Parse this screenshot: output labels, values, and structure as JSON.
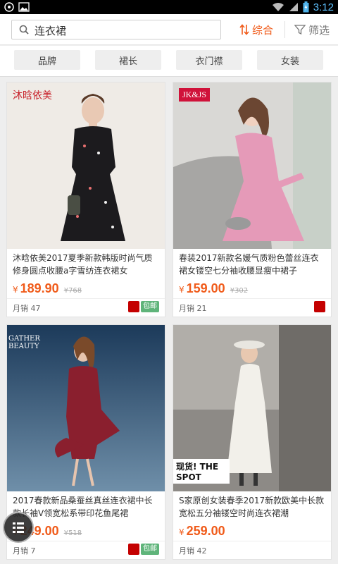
{
  "status_bar": {
    "time": "3:12"
  },
  "search": {
    "query": "连衣裙"
  },
  "sort": {
    "label": "综合"
  },
  "filter": {
    "label": "筛选"
  },
  "chips": [
    "品牌",
    "裙长",
    "衣门襟",
    "女装"
  ],
  "products": [
    {
      "brand_label": "沐晗依美",
      "title": "沐晗依美2017夏季新款韩版时尚气质修身圆点收腰a字雪纺连衣裙女",
      "currency": "¥",
      "price": "189.90",
      "original_price": "¥768",
      "sales": "月销 47",
      "badge": "包邮"
    },
    {
      "brand_label": "JK&JS",
      "title": "春装2017新款名媛气质粉色蕾丝连衣裙女镂空七分袖收腰显瘦中裙子",
      "currency": "¥",
      "price": "159.00",
      "original_price": "¥302",
      "sales": "月销 21",
      "badge": ""
    },
    {
      "brand_label": "GATHER BEAUTY",
      "title": "2017春款新品桑蚕丝真丝连衣裙中长款长袖V领宽松系带印花鱼尾裙",
      "currency": "¥",
      "price": "249.00",
      "original_price": "¥518",
      "sales": "月销 7",
      "badge": "包邮"
    },
    {
      "brand_label": "现货! THE SPOT",
      "title": "S家原创女装春季2017新款欧美中长款宽松五分袖镂空时尚连衣裙潮",
      "currency": "¥",
      "price": "259.00",
      "original_price": "",
      "sales": "月销 42",
      "badge": ""
    }
  ],
  "colors": {
    "accent": "#f05b1a",
    "free_ship": "#5fb47a",
    "tmall": "#c40000"
  }
}
